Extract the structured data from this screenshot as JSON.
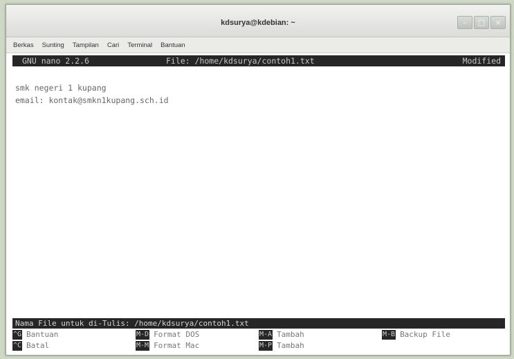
{
  "window": {
    "title": "kdsurya@kdebian: ~",
    "controls": [
      {
        "name": "minimize",
        "glyph": "–"
      },
      {
        "name": "maximize",
        "glyph": "□"
      },
      {
        "name": "close",
        "glyph": "×"
      }
    ]
  },
  "menubar": {
    "items": [
      "Berkas",
      "Sunting",
      "Tampilan",
      "Cari",
      "Terminal",
      "Bantuan"
    ]
  },
  "nano": {
    "header": {
      "version": "GNU nano 2.2.6",
      "file": "File: /home/kdsurya/contoh1.txt",
      "status": "Modified"
    },
    "lines": [
      "smk negeri 1 kupang",
      "email: kontak@smkn1kupang.sch.id"
    ],
    "prompt": "Nama File untuk di-Tulis: /home/kdsurya/contoh1.txt",
    "shortcuts": [
      {
        "key": "^G",
        "label": "Bantuan"
      },
      {
        "key": "M-D",
        "label": "Format DOS"
      },
      {
        "key": "M-A",
        "label": "Tambah"
      },
      {
        "key": "M-B",
        "label": "Backup File"
      },
      {
        "key": "^C",
        "label": "Batal"
      },
      {
        "key": "M-M",
        "label": "Format Mac"
      },
      {
        "key": "M-P",
        "label": "Tambah"
      }
    ]
  }
}
